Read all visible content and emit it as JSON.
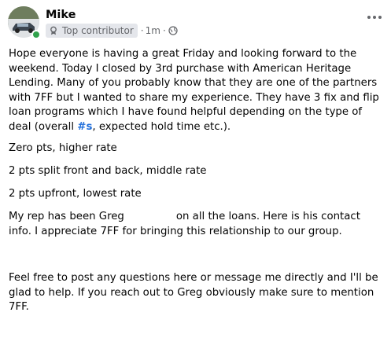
{
  "post": {
    "author": {
      "name": "Mike",
      "badge": "Top contributor"
    },
    "meta": {
      "separator": "·",
      "time": "1m",
      "dot": "·",
      "privacy_icon": "globe-icon"
    },
    "more_icon": "more-horizontal-icon",
    "body": {
      "p1_before_tag": "Hope everyone is having a great Friday and looking forward to the weekend.  Today I closed by 3rd purchase with American Heritage Lending.  Many of you probably know that they are one of the partners with 7FF but I wanted to share my experience.  They have 3 fix and flip loan programs which I have found helpful depending on the type of deal (overall ",
      "p1_tag": "#s",
      "p1_after_tag": ", expected hold time etc.).",
      "p2": "Zero pts, higher rate",
      "p3": "2 pts split front and back, middle rate",
      "p4": "2 pts upfront, lowest rate",
      "p5_part1": "My rep has been Greg",
      "p5_part2": "on all the loans.  Here is his contact info.  I appreciate 7FF for bringing this relationship to our group.",
      "p6": "Feel free to post any questions here or message me directly and I'll be glad to help.  If you reach out to Greg obviously make sure to mention 7FF."
    },
    "colors": {
      "link": "#216fdb",
      "online": "#31a24c",
      "meta": "#65676b"
    }
  }
}
